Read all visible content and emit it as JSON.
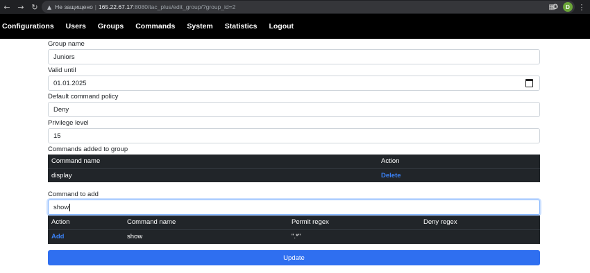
{
  "browser": {
    "security_label": "Не защищено",
    "url_host": "165.22.67.17",
    "url_rest": ":8080/tac_plus/edit_group/?group_id=2",
    "avatar_letter": "D"
  },
  "nav": {
    "items": [
      "Configurations",
      "Users",
      "Groups",
      "Commands",
      "System",
      "Statistics",
      "Logout"
    ]
  },
  "form": {
    "group_name": {
      "label": "Group name",
      "value": "Juniors"
    },
    "valid_until": {
      "label": "Valid until",
      "value": "01.01.2025"
    },
    "policy": {
      "label": "Default command policy",
      "value": "Deny"
    },
    "privilege": {
      "label": "Privilege level",
      "value": "15"
    },
    "commands_added": {
      "label": "Commands added to group",
      "headers": [
        "Command name",
        "Action"
      ],
      "rows": [
        {
          "command": "display",
          "action": "Delete"
        }
      ]
    },
    "command_to_add": {
      "label": "Command to add",
      "value": "show"
    },
    "search_results": {
      "headers": [
        "Action",
        "Command name",
        "Permit regex",
        "Deny regex"
      ],
      "rows": [
        {
          "action": "Add",
          "command": "show",
          "permit": "\".*\"",
          "deny": ""
        }
      ]
    },
    "update_label": "Update"
  },
  "colors": {
    "navbar": "#000000",
    "table": "#212529",
    "accent": "#2f6ff0",
    "link": "#3b82f6"
  }
}
